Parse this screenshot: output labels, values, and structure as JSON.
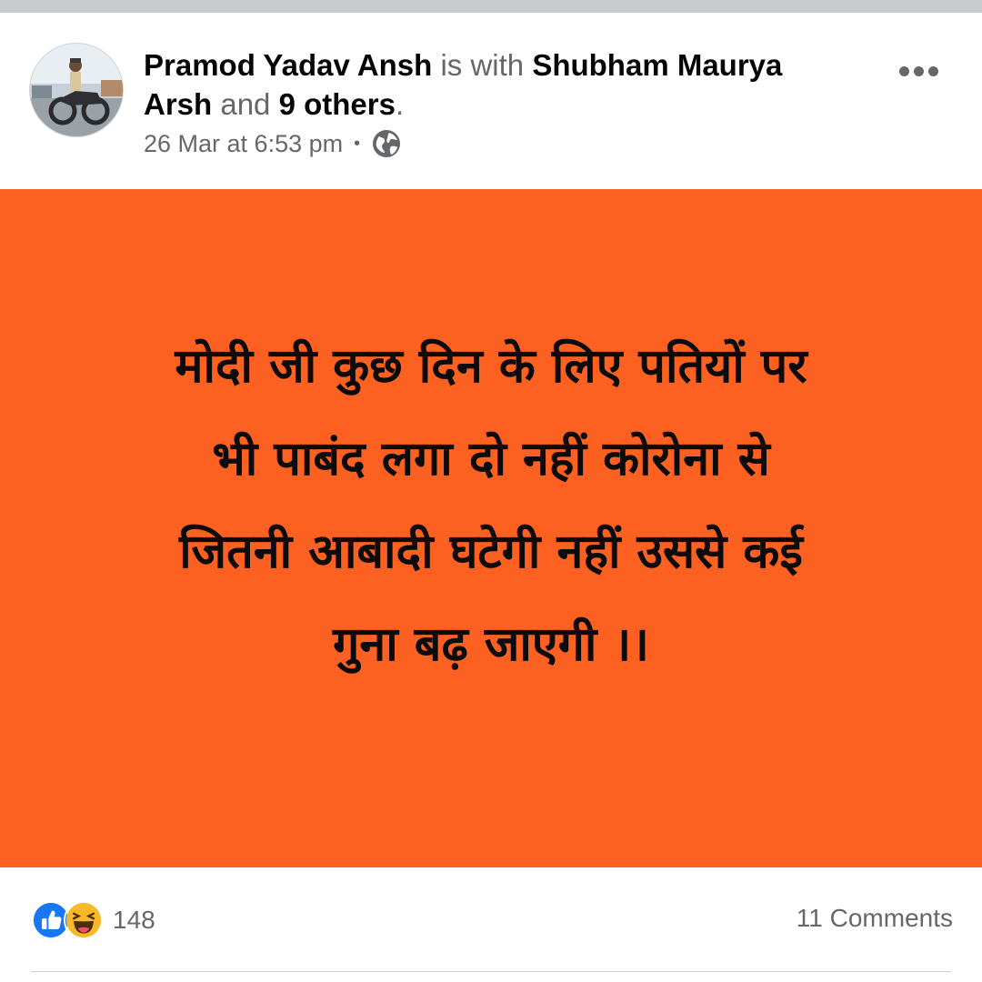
{
  "post": {
    "author": "Pramod Yadav Ansh",
    "with_text": " is with ",
    "tagged": "Shubham Maurya Arsh",
    "and_text": " and ",
    "others": "9 others",
    "period": ".",
    "timestamp": "26 Mar at 6:53 pm",
    "dot": "•",
    "privacy_icon": "globe-icon",
    "more_icon": "more-options-icon",
    "background_color": "#fd6121",
    "text_lines": [
      "मोदी जी कुछ दिन के लिए पतियों पर",
      "भी पाबंद लगा दो नहीं कोरोना से",
      "जितनी आबादी घटेगी नहीं उससे कई",
      "गुना बढ़ जाएगी ।।"
    ]
  },
  "footer": {
    "reaction_icons": [
      "like-icon",
      "haha-icon"
    ],
    "reaction_count": "148",
    "comments": "11 Comments"
  }
}
